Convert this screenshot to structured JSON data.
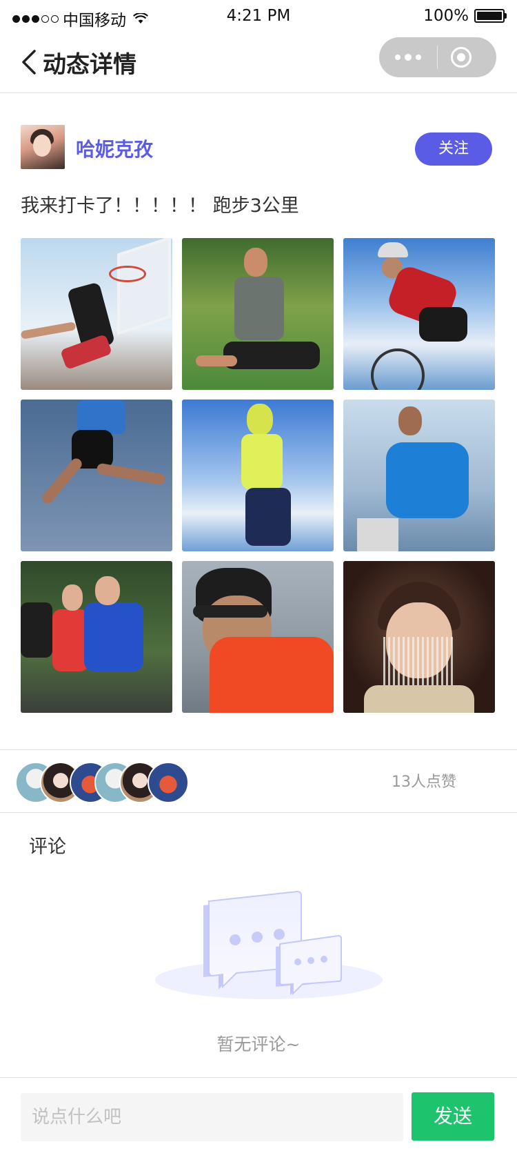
{
  "status_bar": {
    "carrier": "中国移动",
    "time": "4:21 PM",
    "battery": "100%",
    "battery_level": 1.0
  },
  "nav": {
    "title": "动态详情"
  },
  "post": {
    "author_name": "哈妮克孜",
    "follow_label": "关注",
    "text": "我来打卡了！！！！！ 跑步3公里",
    "photos": [
      "basketball-dunk",
      "stretching-man",
      "cyclist",
      "jumping-runner",
      "woman-runner",
      "man-running-blue",
      "marathon-group",
      "runner-sunglasses",
      "woman-veil-portrait"
    ]
  },
  "likes": {
    "count_text": "13人点赞",
    "liker_avatars": [
      "liker-a",
      "liker-b",
      "liker-c",
      "liker-a",
      "liker-b",
      "liker-c"
    ]
  },
  "comments": {
    "title": "评论",
    "empty_text": "暂无评论~"
  },
  "input_bar": {
    "placeholder": "说点什么吧",
    "value": "",
    "send_label": "发送"
  },
  "colors": {
    "accent": "#5b5ce6",
    "send": "#1ec46d",
    "capsule": "#c9c9c9"
  }
}
